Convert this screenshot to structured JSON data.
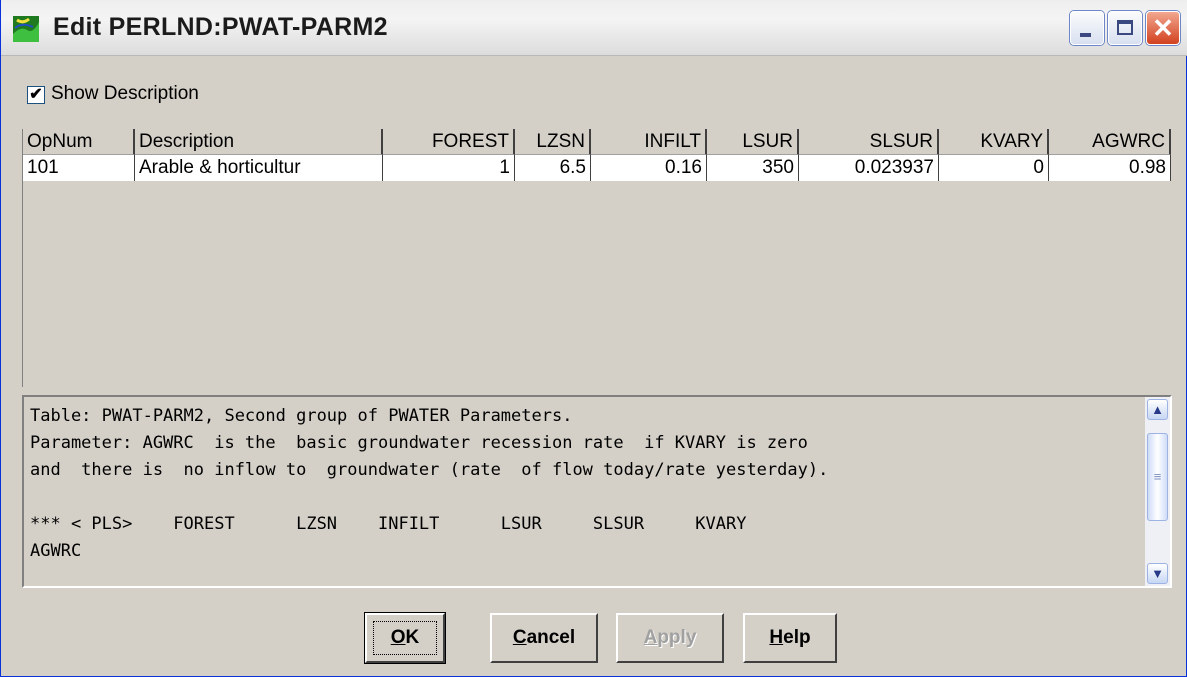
{
  "window": {
    "title": "Edit PERLND:PWAT-PARM2",
    "app_icon": "perlnd-app-icon",
    "controls": {
      "minimize": "minimize-icon",
      "maximize": "maximize-icon",
      "close": "close-icon"
    }
  },
  "show_description": {
    "label": "Show Description",
    "checked": true
  },
  "grid": {
    "columns": [
      "OpNum",
      "Description",
      "FOREST",
      "LZSN",
      "INFILT",
      "LSUR",
      "SLSUR",
      "KVARY",
      "AGWRC"
    ],
    "rows": [
      [
        "101",
        "Arable & horticultur",
        "1",
        "6.5",
        "0.16",
        "350",
        "0.023937",
        "0",
        "0.98"
      ]
    ]
  },
  "description_box": {
    "lines": [
      "Table: PWAT-PARM2, Second group of PWATER Parameters.",
      "Parameter: AGWRC  is the  basic groundwater recession rate  if KVARY is zero",
      "and  there is  no inflow to  groundwater (rate  of flow today/rate yesterday).",
      "",
      "*** < PLS>    FOREST      LZSN    INFILT      LSUR     SLSUR     KVARY",
      "AGWRC"
    ]
  },
  "buttons": {
    "ok": {
      "mnemonic": "O",
      "rest": "K"
    },
    "cancel": {
      "mnemonic": "C",
      "rest": "ancel"
    },
    "apply": {
      "mnemonic": "A",
      "rest": "pply"
    },
    "help": {
      "mnemonic": "H",
      "rest": "elp"
    }
  }
}
